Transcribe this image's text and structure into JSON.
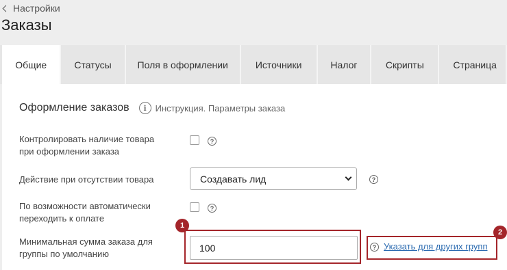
{
  "header": {
    "back_label": "Настройки",
    "title": "Заказы"
  },
  "tabs": [
    {
      "label": "Общие",
      "active": true
    },
    {
      "label": "Статусы"
    },
    {
      "label": "Поля в оформлении"
    },
    {
      "label": "Источники"
    },
    {
      "label": "Налог"
    },
    {
      "label": "Скрипты"
    },
    {
      "label": "Страница"
    }
  ],
  "section": {
    "title": "Оформление заказов",
    "instruction_link": "Инструкция. Параметры заказа"
  },
  "settings": {
    "check_stock_label": "Контролировать наличие товара при оформлении заказа",
    "check_stock_checked": false,
    "out_of_stock_action_label": "Действие при отсутствии товара",
    "out_of_stock_action_value": "Создавать лид",
    "auto_payment_label": "По возможности автоматически переходить к оплате",
    "auto_payment_checked": false,
    "min_order_label": "Минимальная сумма заказа для группы по умолчанию",
    "min_order_value": "100",
    "other_groups_link": "Указать для других групп"
  },
  "annotations": {
    "badge_1": "1",
    "badge_2": "2",
    "color": "#a4252a"
  },
  "help_glyph": "?",
  "info_glyph": "i",
  "colors": {
    "link": "#2a6ab0",
    "tab_inactive": "#e6e6e6",
    "page_bg": "#eeeeee"
  }
}
